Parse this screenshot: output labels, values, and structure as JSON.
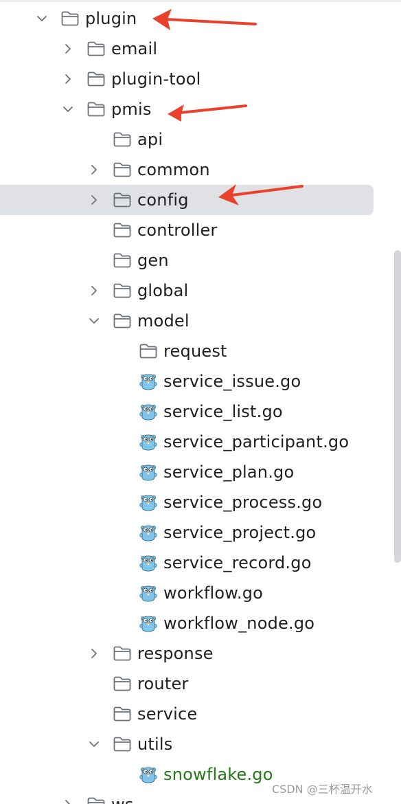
{
  "tree": {
    "rows": [
      {
        "label": "plugin",
        "kind": "folder",
        "state": "expanded",
        "depth": 0
      },
      {
        "label": "email",
        "kind": "folder",
        "state": "collapsed",
        "depth": 1
      },
      {
        "label": "plugin-tool",
        "kind": "folder",
        "state": "collapsed",
        "depth": 1
      },
      {
        "label": "pmis",
        "kind": "folder",
        "state": "expanded",
        "depth": 1
      },
      {
        "label": "api",
        "kind": "folder",
        "state": "leaf",
        "depth": 2
      },
      {
        "label": "common",
        "kind": "folder",
        "state": "collapsed",
        "depth": 2
      },
      {
        "label": "config",
        "kind": "folder",
        "state": "collapsed",
        "depth": 2,
        "selected": true
      },
      {
        "label": "controller",
        "kind": "folder",
        "state": "leaf",
        "depth": 2
      },
      {
        "label": "gen",
        "kind": "folder",
        "state": "leaf",
        "depth": 2
      },
      {
        "label": "global",
        "kind": "folder",
        "state": "collapsed",
        "depth": 2
      },
      {
        "label": "model",
        "kind": "folder",
        "state": "expanded",
        "depth": 2
      },
      {
        "label": "request",
        "kind": "folder",
        "state": "leaf",
        "depth": 3
      },
      {
        "label": "service_issue.go",
        "kind": "go-file",
        "state": "leaf",
        "depth": 3
      },
      {
        "label": "service_list.go",
        "kind": "go-file",
        "state": "leaf",
        "depth": 3
      },
      {
        "label": "service_participant.go",
        "kind": "go-file",
        "state": "leaf",
        "depth": 3
      },
      {
        "label": "service_plan.go",
        "kind": "go-file",
        "state": "leaf",
        "depth": 3
      },
      {
        "label": "service_process.go",
        "kind": "go-file",
        "state": "leaf",
        "depth": 3
      },
      {
        "label": "service_project.go",
        "kind": "go-file",
        "state": "leaf",
        "depth": 3
      },
      {
        "label": "service_record.go",
        "kind": "go-file",
        "state": "leaf",
        "depth": 3
      },
      {
        "label": "workflow.go",
        "kind": "go-file",
        "state": "leaf",
        "depth": 3
      },
      {
        "label": "workflow_node.go",
        "kind": "go-file",
        "state": "leaf",
        "depth": 3
      },
      {
        "label": "response",
        "kind": "folder",
        "state": "collapsed",
        "depth": 2
      },
      {
        "label": "router",
        "kind": "folder",
        "state": "leaf",
        "depth": 2
      },
      {
        "label": "service",
        "kind": "folder",
        "state": "leaf",
        "depth": 2
      },
      {
        "label": "utils",
        "kind": "folder",
        "state": "expanded",
        "depth": 2
      },
      {
        "label": "snowflake.go",
        "kind": "go-file",
        "state": "leaf",
        "depth": 3,
        "vcs_status": "added"
      },
      {
        "label": "ws",
        "kind": "folder",
        "state": "collapsed",
        "depth": 1
      }
    ]
  },
  "annotations": {
    "arrow_color": "#e8412c",
    "pointed_rows": [
      "plugin",
      "pmis",
      "config"
    ]
  },
  "colors": {
    "selection_bg": "#dfe1e5",
    "text": "#1e1f22",
    "vcs_added_text": "#237a16",
    "folder_stroke": "#6c707e",
    "gopher_blue": "#7fc6ea"
  },
  "watermark": {
    "text": "CSDN @三杯温开水"
  }
}
